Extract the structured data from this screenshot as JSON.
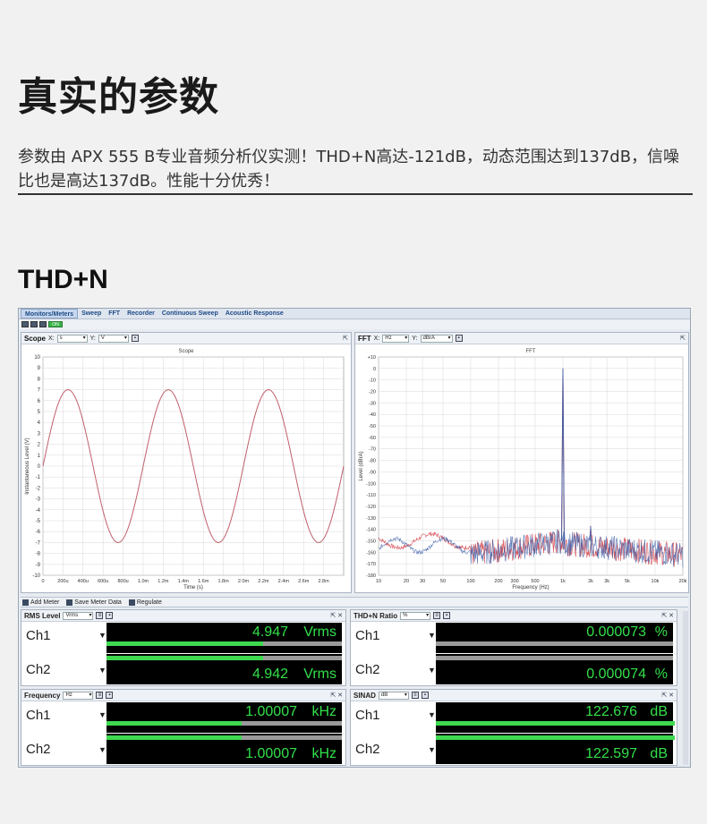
{
  "heading": "真实的参数",
  "intro": "参数由 APX 555 B专业音频分析仪实测！THD+N高达-121dB，动态范围达到137dB，信噪比也是高达137dB。性能十分优秀！",
  "section": "THD+N",
  "app": {
    "tabs": [
      "Monitors/Meters",
      "Sweep",
      "FFT",
      "Recorder",
      "Continuous Sweep",
      "Acoustic Response"
    ],
    "on_label": "ON",
    "scope": {
      "panel_title": "Scope",
      "x_label": "X:",
      "x_unit": "s",
      "y_label": "Y:",
      "y_unit": "V",
      "chart_title": "Scope",
      "xlabel": "Time (s)",
      "ylabel": "Instantaneous Level (V)"
    },
    "fft": {
      "panel_title": "FFT",
      "x_label": "X:",
      "x_unit": "Hz",
      "y_label": "Y:",
      "y_unit": "dBrA",
      "chart_title": "FFT",
      "xlabel": "Frequency (Hz)",
      "ylabel": "Level (dBrA)"
    },
    "toolbar": {
      "add_meter": "Add Meter",
      "save_meter_data": "Save Meter Data",
      "regulate": "Regulate"
    },
    "meters": [
      {
        "title": "RMS Level",
        "unit_select": "Vrms",
        "rows": [
          {
            "channel": "Ch1",
            "value": "4.947",
            "unit": "Vrms",
            "fill": 0.66
          },
          {
            "channel": "Ch2",
            "value": "4.942",
            "unit": "Vrms",
            "fill": 0.66
          }
        ]
      },
      {
        "title": "THD+N Ratio",
        "unit_select": "%",
        "rows": [
          {
            "channel": "Ch1",
            "value": "0.000073",
            "unit": "%",
            "fill": 0.0
          },
          {
            "channel": "Ch2",
            "value": "0.000074",
            "unit": "%",
            "fill": 0.0
          }
        ]
      },
      {
        "title": "Frequency",
        "unit_select": "Hz",
        "rows": [
          {
            "channel": "Ch1",
            "value": "1.00007",
            "unit": "kHz",
            "fill": 0.57
          },
          {
            "channel": "Ch2",
            "value": "1.00007",
            "unit": "kHz",
            "fill": 0.57
          }
        ]
      },
      {
        "title": "SINAD",
        "unit_select": "dB",
        "rows": [
          {
            "channel": "Ch1",
            "value": "122.676",
            "unit": "dB",
            "fill": 1.0
          },
          {
            "channel": "Ch2",
            "value": "122.597",
            "unit": "dB",
            "fill": 1.0
          }
        ]
      }
    ]
  },
  "chart_data": [
    {
      "type": "line",
      "title": "Scope",
      "xlabel": "Time (s)",
      "ylabel": "Instantaneous Level (V)",
      "x_ticks": [
        "0",
        "200u",
        "400u",
        "600u",
        "800u",
        "1.0m",
        "1.2m",
        "1.4m",
        "1.6m",
        "1.8m",
        "2.0m",
        "2.2m",
        "2.4m",
        "2.6m",
        "2.8m"
      ],
      "y_ticks": [
        10,
        9,
        8,
        7,
        6,
        5,
        4,
        3,
        2,
        1,
        0,
        -1,
        -2,
        -3,
        -4,
        -5,
        -6,
        -7,
        -8,
        -9,
        -10
      ],
      "xlim": [
        0,
        0.003
      ],
      "ylim": [
        -10,
        10
      ],
      "series": [
        {
          "frequency_hz": 1000,
          "amplitude_v": 7.0,
          "color": "#c0606a"
        }
      ],
      "grid": true
    },
    {
      "type": "line",
      "title": "FFT",
      "xlabel": "Frequency (Hz)",
      "ylabel": "Level (dBrA)",
      "x_scale": "log",
      "x_ticks": [
        "10",
        "20",
        "30",
        "50",
        "100",
        "200",
        "300",
        "500",
        "1k",
        "2k",
        "3k",
        "5k",
        "10k",
        "20k"
      ],
      "y_ticks": [
        "+10",
        "0",
        "-10",
        "-20",
        "-30",
        "-40",
        "-50",
        "-60",
        "-70",
        "-80",
        "-90",
        "-100",
        "-110",
        "-120",
        "-130",
        "-140",
        "-150",
        "-160",
        "-170",
        "-180"
      ],
      "xlim": [
        10,
        20000
      ],
      "ylim": [
        -180,
        10
      ],
      "series": [
        {
          "color": "#d0303a",
          "peak": {
            "x": 1000,
            "y": 0
          }
        },
        {
          "color": "#4060a8",
          "peak": {
            "x": 1000,
            "y": 0
          }
        }
      ],
      "noise_floor_db": -160,
      "grid": true
    }
  ]
}
